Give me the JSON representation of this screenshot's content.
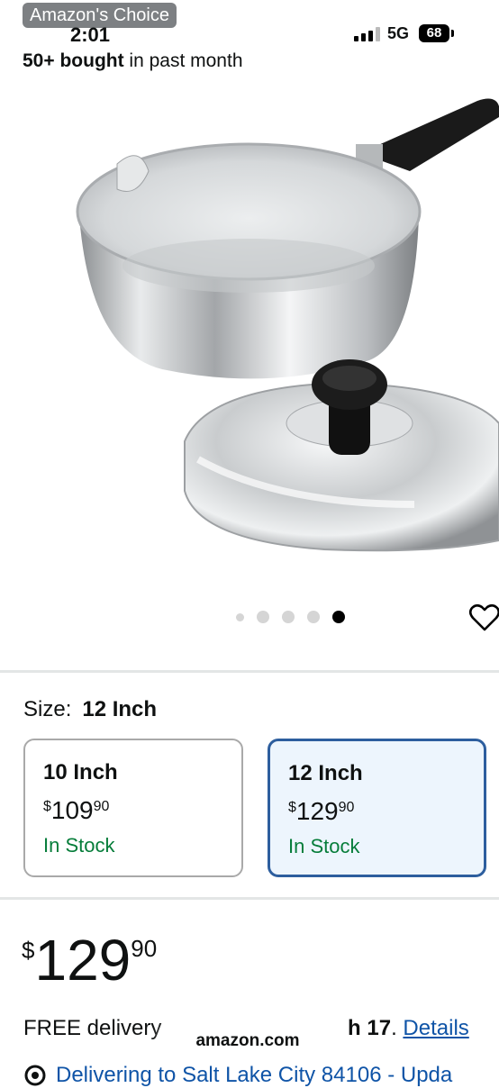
{
  "status_bar": {
    "badge": "Amazon's Choice",
    "time": "2:01",
    "network": "5G",
    "battery": "68"
  },
  "social_proof": {
    "bold": "50+ bought",
    "rest": " in past month"
  },
  "gallery": {
    "image_count": 5,
    "active_index": 4
  },
  "size": {
    "label": "Size:",
    "selected": "12 Inch",
    "options": [
      {
        "name": "10 Inch",
        "currency": "$",
        "whole": "109",
        "fraction": "90",
        "stock": "In Stock"
      },
      {
        "name": "12 Inch",
        "currency": "$",
        "whole": "129",
        "fraction": "90",
        "stock": "In Stock"
      }
    ]
  },
  "price": {
    "currency": "$",
    "whole": "129",
    "fraction": "90"
  },
  "delivery": {
    "prefix": "FREE delivery ",
    "date": "h 17",
    "period": ". ",
    "details_link": "Details"
  },
  "browser": {
    "url": "amazon.com"
  },
  "location": {
    "text": "Delivering to Salt Lake City 84106 - Upda"
  },
  "colors": {
    "in_stock": "#067d3a",
    "selected_border": "#2d5e9e",
    "link": "#0f54a7"
  }
}
